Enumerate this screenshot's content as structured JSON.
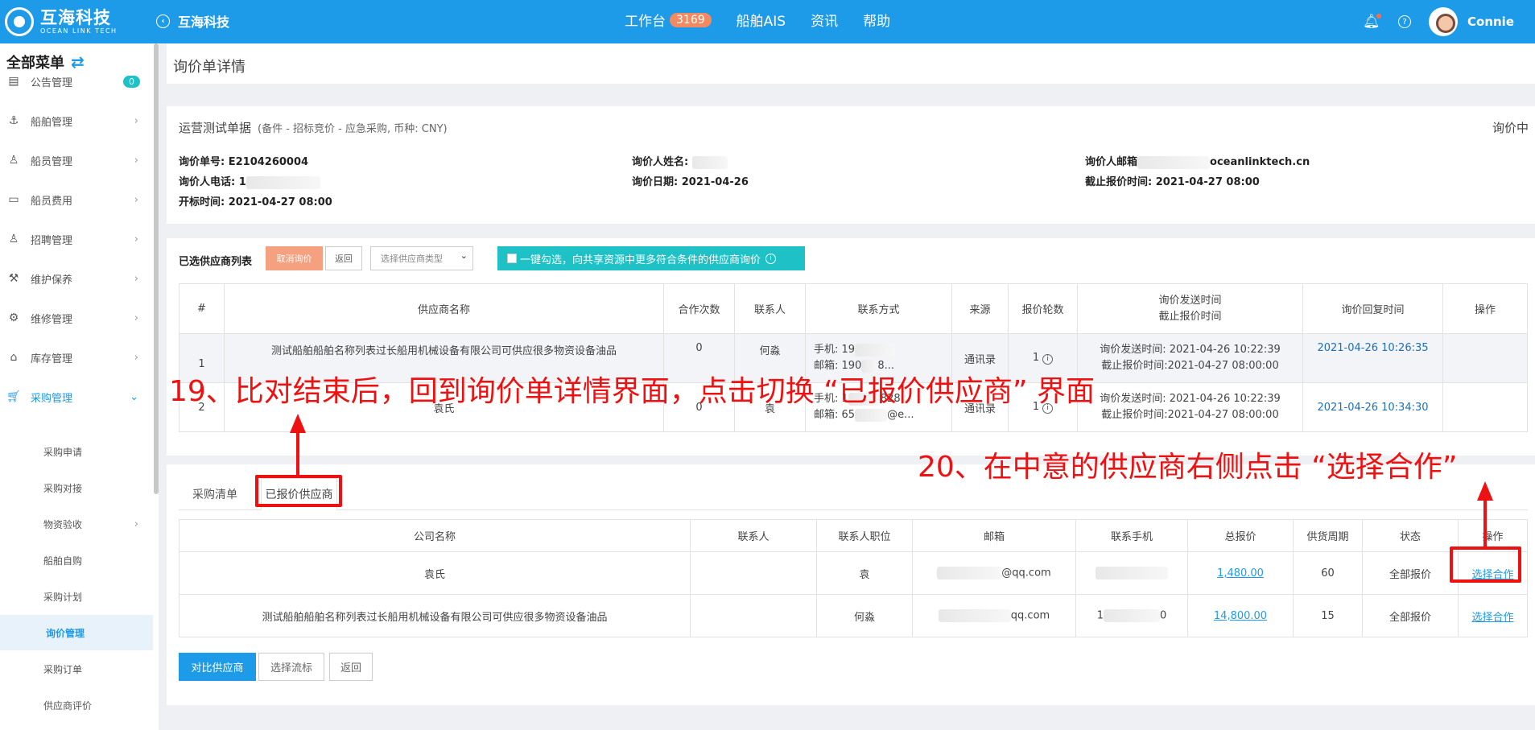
{
  "header": {
    "logo_cn": "互海科技",
    "logo_en": "OCEAN LINK TECH",
    "back_label": "互海科技",
    "nav": [
      {
        "label": "工作台",
        "badge": "3169"
      },
      {
        "label": "船舶AIS"
      },
      {
        "label": "资讯"
      },
      {
        "label": "帮助"
      }
    ],
    "user": "Connie",
    "accent": "#1e9be8"
  },
  "sidebar": {
    "title": "全部菜单",
    "items": [
      {
        "label": "公告管理",
        "icon": "book-icon",
        "badge": "0"
      },
      {
        "label": "船舶管理",
        "icon": "anchor-icon"
      },
      {
        "label": "船员管理",
        "icon": "person-icon"
      },
      {
        "label": "船员费用",
        "icon": "wallet-icon"
      },
      {
        "label": "招聘管理",
        "icon": "person-icon"
      },
      {
        "label": "维护保养",
        "icon": "tool-icon"
      },
      {
        "label": "维修管理",
        "icon": "wrench-icon"
      },
      {
        "label": "库存管理",
        "icon": "home-icon"
      },
      {
        "label": "采购管理",
        "icon": "cart-icon"
      }
    ],
    "sub_items": [
      {
        "label": "采购申请"
      },
      {
        "label": "采购对接"
      },
      {
        "label": "物资验收"
      },
      {
        "label": "船舶自购"
      },
      {
        "label": "采购计划"
      },
      {
        "label": "询价管理"
      },
      {
        "label": "采购订单"
      },
      {
        "label": "供应商评价"
      }
    ]
  },
  "page": {
    "title": "询价单详情"
  },
  "inquiry": {
    "title": "运营测试单据",
    "subtitle": "(备件 - 招标竞价 - 应急采购, 币种: CNY)",
    "status": "询价中",
    "no_label": "询价单号: E2104260004",
    "phone_label": "询价人电话: 1",
    "open_time": "开标时间: 2021-04-27 08:00",
    "name_label": "询价人姓名:",
    "date_label": "询价日期: 2021-04-26",
    "email_label": "询价人邮箱",
    "email_suffix": "oceanlinktech.cn",
    "deadline": "截止报价时间: 2021-04-27 08:00"
  },
  "supplier_list": {
    "label": "已选供应商列表",
    "cancel_btn": "取消询价",
    "back_btn": "返回",
    "type_select": "选择供应商类型",
    "onekey_btn": "一键勾选，向共享资源中更多符合条件的供应商询价",
    "columns": [
      "#",
      "供应商名称",
      "合作次数",
      "联系人",
      "联系方式",
      "来源",
      "报价轮数",
      "询价发送时间",
      "截止报价时间",
      "询价回复时间",
      "操作"
    ],
    "rows": [
      {
        "idx": "1",
        "name": "测试船舶船舶名称列表过长船用机械设备有限公司可供应很多物资设备油品",
        "times": "0",
        "contact": "何淼",
        "phone": "手机: 19",
        "email": "邮箱: 190",
        "email_tail": "8...",
        "source": "通讯录",
        "rounds": "1",
        "send": "询价发送时间: 2021-04-26 10:22:39",
        "deadline": "截止报价时间:2021-04-27 08:00:00",
        "reply": "2021-04-26 10:26:35"
      },
      {
        "idx": "2",
        "name": "袁氏",
        "times": "0",
        "contact": "袁",
        "phone": "手机: 1",
        "phone_tail": "828",
        "email": "邮箱: 65",
        "email_tail": "@e...",
        "source": "通讯录",
        "rounds": "1",
        "send": "询价发送时间: 2021-04-26 10:22:39",
        "deadline": "截止报价时间:2021-04-27 08:00:00",
        "reply": "2021-04-26 10:34:30"
      }
    ]
  },
  "quotes": {
    "tabs": [
      "采购清单",
      "已报价供应商"
    ],
    "columns": [
      "公司名称",
      "联系人",
      "联系人职位",
      "邮箱",
      "联系手机",
      "总报价",
      "供货周期",
      "状态",
      "操作"
    ],
    "rows": [
      {
        "company": "袁氏",
        "contact": "",
        "position": "袁",
        "email": "@qq.com",
        "phone": "",
        "total": "1,480.00",
        "cycle": "60",
        "status": "全部报价",
        "action": "选择合作"
      },
      {
        "company": "测试船舶船舶名称列表过长船用机械设备有限公司可供应很多物资设备油品",
        "contact": "",
        "position": "何淼",
        "email": "qq.com",
        "phone": "1",
        "phone_tail": "0",
        "total": "14,800.00",
        "cycle": "15",
        "status": "全部报价",
        "action": "选择合作"
      }
    ],
    "compare_btn": "对比供应商",
    "flow_btn": "选择流标",
    "back_btn": "返回"
  },
  "annotations": {
    "step19": "19、比对结束后，回到询价单详情界面，点击切换 “已报价供应商” 界面",
    "step20": "20、在中意的供应商右侧点击 “选择合作”",
    "color": "#ee1111"
  }
}
